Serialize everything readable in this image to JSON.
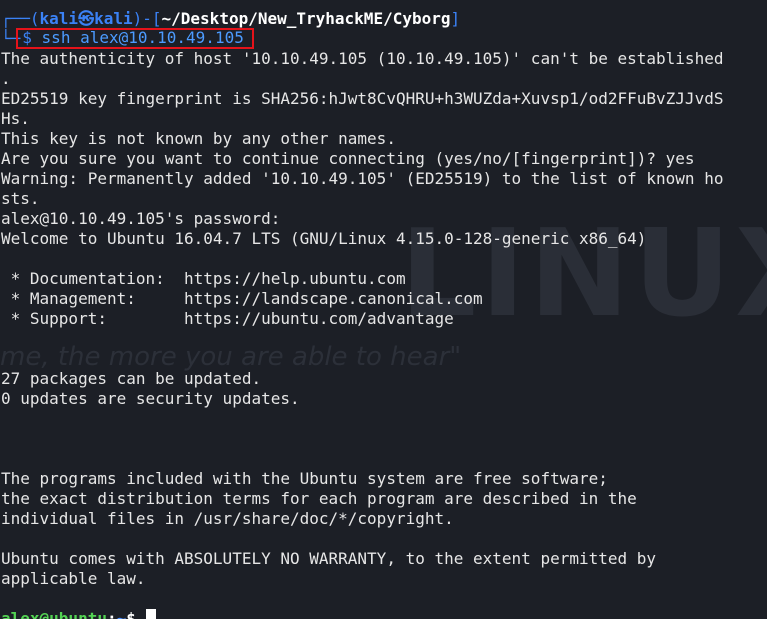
{
  "prompt": {
    "frame_top_left": "┌──(",
    "user": "kali",
    "symbol": "㉿",
    "host": "kali",
    "frame_mid": ")-[",
    "cwd": "~/Desktop/New_TryhackME/Cyborg",
    "frame_end": "]",
    "frame_bottom": "└─",
    "dollar": "$",
    "command": "ssh alex@10.10.49.105"
  },
  "output_lines": [
    "The authenticity of host '10.10.49.105 (10.10.49.105)' can't be established",
    ".",
    "ED25519 key fingerprint is SHA256:hJwt8CvQHRU+h3WUZda+Xuvsp1/od2FFuBvZJJvdS",
    "Hs.",
    "This key is not known by any other names.",
    "Are you sure you want to continue connecting (yes/no/[fingerprint])? yes",
    "Warning: Permanently added '10.10.49.105' (ED25519) to the list of known ho",
    "sts.",
    "alex@10.10.49.105's password:",
    "Welcome to Ubuntu 16.04.7 LTS (GNU/Linux 4.15.0-128-generic x86_64)",
    "",
    " * Documentation:  https://help.ubuntu.com",
    " * Management:     https://landscape.canonical.com",
    " * Support:        https://ubuntu.com/advantage",
    "",
    "",
    "27 packages can be updated.",
    "0 updates are security updates.",
    "",
    "",
    "",
    "The programs included with the Ubuntu system are free software;",
    "the exact distribution terms for each program are described in the",
    "individual files in /usr/share/doc/*/copyright.",
    "",
    "Ubuntu comes with ABSOLUTELY NO WARRANTY, to the extent permitted by",
    "applicable law.",
    ""
  ],
  "remote_prompt": {
    "user_host": "alex@ubuntu",
    "colon": ":",
    "path": "~",
    "dollar": "$ "
  },
  "watermark": {
    "logo_text": "LINUX",
    "quote_text": "me, the more you are able to hear\""
  },
  "colors": {
    "background": "#1c1f26",
    "text": "#e6e6e6",
    "prompt_blue": "#3b82f6",
    "highlight_box": "#e5131a",
    "remote_user_green": "#53d353"
  }
}
